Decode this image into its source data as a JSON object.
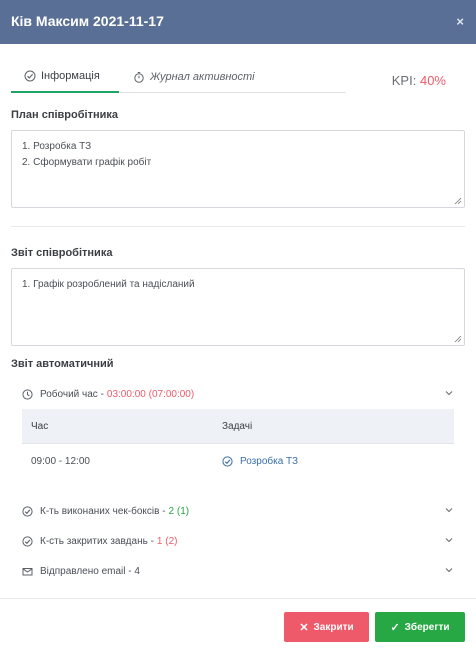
{
  "header": {
    "title": "Ків Максим 2021-11-17",
    "close_icon": "×"
  },
  "tabs": [
    {
      "label": "Інформація",
      "icon": "check-circle-icon",
      "active": true
    },
    {
      "label": "Журнал активності",
      "icon": "stopwatch-icon",
      "active": false
    }
  ],
  "kpi": {
    "label": "KPI:",
    "value": "40%"
  },
  "plan": {
    "label": "План співробітника",
    "lines": [
      "1. Розробка ТЗ",
      "2. Сформувати графік робіт"
    ]
  },
  "report": {
    "label": "Звіт співробітника",
    "lines": [
      "1. Графік розроблений та надісланий"
    ]
  },
  "auto": {
    "label": "Звіт автоматичний",
    "work_time": {
      "label": "Робочий час - ",
      "value": "03:00:00 (07:00:00)"
    },
    "table": {
      "columns": [
        "Час",
        "Задачі"
      ],
      "rows": [
        {
          "time": "09:00 - 12:00",
          "task": "Розробка ТЗ"
        }
      ]
    },
    "checkboxes": {
      "label": "К-ть виконаних чек-боксів - ",
      "value": "2 (1)"
    },
    "closed_tasks": {
      "label": "К-сть закритих завдань - ",
      "value": "1 (2)"
    },
    "emails": {
      "label": "Відправлено email - 4"
    }
  },
  "footer": {
    "close_label": "Закрити",
    "save_label": "Зберегти"
  },
  "colors": {
    "header": "#5a6f95",
    "accent_green": "#28a745",
    "accent_red": "#ef5a6a",
    "link": "#3a6ea8"
  }
}
